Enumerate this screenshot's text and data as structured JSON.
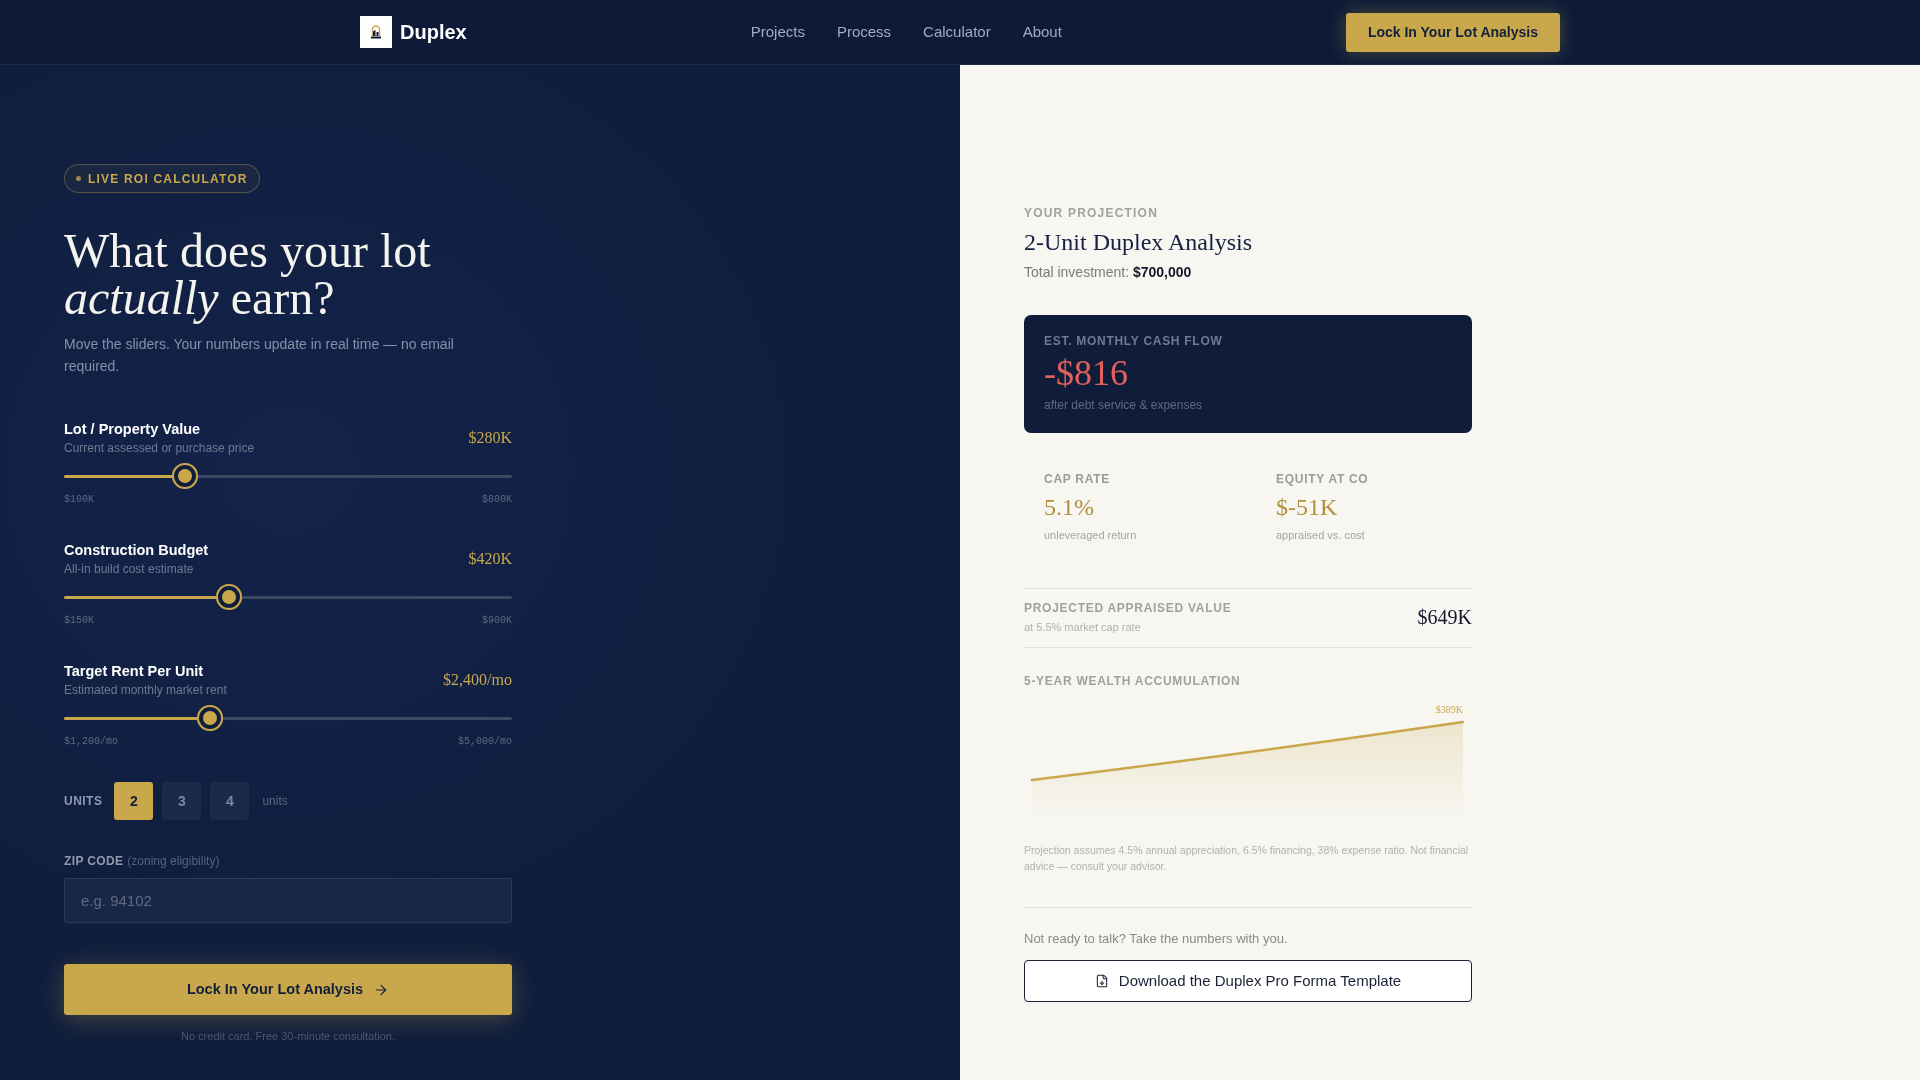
{
  "header": {
    "logo": "Duplex",
    "nav": [
      {
        "label": "Projects"
      },
      {
        "label": "Process"
      },
      {
        "label": "Calculator"
      },
      {
        "label": "About"
      }
    ],
    "cta": "Lock In Your Lot Analysis"
  },
  "calculator": {
    "badge": "LIVE ROI CALCULATOR",
    "headline": "What does your lot *actually* earn?",
    "intro": "Move the sliders. Your numbers update in real time — no email required.",
    "sliders": [
      {
        "label": "Lot / Property Value",
        "hint": "Current assessed or purchase price",
        "value": "$280K",
        "level": 0.257,
        "min": "$100K",
        "max": "$800K"
      },
      {
        "label": "Construction Budget",
        "hint": "All-in build cost estimate",
        "value": "$420K",
        "level": 0.36,
        "min": "$150K",
        "max": "$900K"
      },
      {
        "label": "Target Rent Per Unit",
        "hint": "Estimated monthly market rent",
        "value": "$2,400/mo",
        "level": 0.316,
        "min": "$1,200/mo",
        "max": "$5,000/mo"
      }
    ],
    "units": {
      "label": "UNITS",
      "options": [
        {
          "label": "2",
          "selected": true
        },
        {
          "label": "3",
          "selected": false
        },
        {
          "label": "4",
          "selected": false
        }
      ],
      "suffix": "units"
    },
    "zip": {
      "label": "ZIP CODE",
      "note": "(zoning eligibility)",
      "placeholder": "e.g. 94102"
    },
    "submit": "Lock In Your Lot Analysis",
    "footnote": "No credit card. Free 30-minute consultation."
  },
  "projection": {
    "eyebrow": "YOUR PROJECTION",
    "title": "2-Unit Duplex Analysis",
    "total": "Total investment: **$700,000**",
    "cash_flow": {
      "label": "EST. MONTHLY CASH FLOW",
      "value": "-$816",
      "note": "after debt service & expenses"
    },
    "metrics": [
      {
        "label": "CAP RATE",
        "value": "5.1%",
        "note": "unleveraged return"
      },
      {
        "label": "EQUITY AT CO",
        "value": "$-51K",
        "note": "appraised vs. cost"
      }
    ],
    "appraised": {
      "label": "PROJECTED APPRAISED VALUE",
      "note": "at 5.5% market cap rate",
      "value": "$649K"
    },
    "wealth": {
      "title": "5-YEAR WEALTH ACCUMULATION",
      "end_label": "$389K"
    },
    "disclaimer": "Projection assumes 4.5% annual appreciation, 6.5% financing, 38% expense ratio. Not financial advice — consult your advisor.",
    "download": {
      "prompt": "Not ready to talk? Take the numbers with you.",
      "button": "Download the Duplex Pro Forma Template"
    }
  }
}
